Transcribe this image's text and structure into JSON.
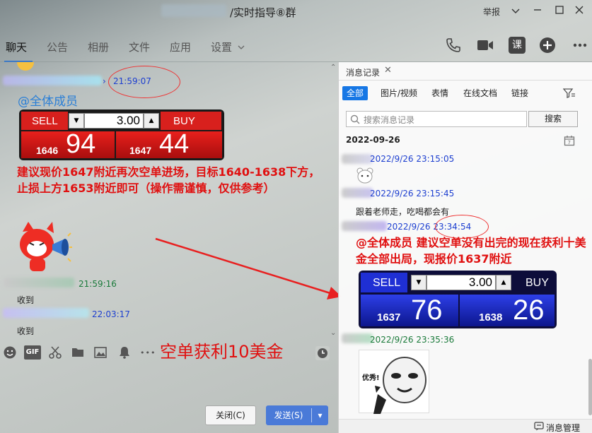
{
  "window": {
    "title": "/实时指导⑧群",
    "report_label": "举报",
    "controls": [
      "chevron-down",
      "minimize",
      "maximize",
      "close"
    ]
  },
  "tabs": [
    {
      "label": "聊天",
      "active": true
    },
    {
      "label": "公告"
    },
    {
      "label": "相册"
    },
    {
      "label": "文件"
    },
    {
      "label": "应用"
    },
    {
      "label": "设置"
    }
  ],
  "toolbar_icons": [
    "phone-icon",
    "video-icon",
    "course-icon",
    "add-icon",
    "more-icon"
  ],
  "toolbar_course_label": "课",
  "chat": {
    "msg1": {
      "time": "21:59:07",
      "arrow": "›",
      "mention": "@全体成员",
      "ticket": {
        "sell_label": "SELL",
        "buy_label": "BUY",
        "qty": "3.00",
        "spin_down": "▼",
        "spin_up": "▲",
        "sell_small": "1646",
        "sell_big": "94",
        "buy_small": "1647",
        "buy_big": "44"
      },
      "text": "建议现价1647附近再次空单进场，目标1640-1638下方，止损上方1653附近即可（操作需谨慎，仅供参考）"
    },
    "msg2": {
      "time": "21:59:16",
      "text": "收到"
    },
    "msg3": {
      "time": "22:03:17",
      "text": "收到"
    },
    "overlay_text": "空单获利10美金"
  },
  "input_toolbar": {
    "icons": [
      "emoji-icon",
      "gif-icon",
      "scissors-icon",
      "folder-icon",
      "image-icon",
      "bell-icon",
      "more-dots-icon"
    ],
    "gif_label": "GIF",
    "more_dots": "•••"
  },
  "buttons": {
    "close": "关闭(C)",
    "send": "发送(S)",
    "send_dropdown": "▾"
  },
  "history": {
    "tab_title": "消息记录",
    "close": "✕",
    "filters": [
      "全部",
      "图片/视频",
      "表情",
      "在线文档",
      "链接"
    ],
    "search_placeholder": "搜索消息记录",
    "search_button": "搜索",
    "date": "2022-09-26",
    "entries": [
      {
        "time": "2022/9/26 23:15:05"
      },
      {
        "time": "2022/9/26 23:15:45",
        "text": "跟着老师走，吃喝都会有"
      },
      {
        "time": "2022/9/26 23:34:54",
        "text": "@全体成员 建议空单没有出完的现在获利十美金全部出局，现报价1637附近"
      },
      {
        "time": "2022/9/26 23:35:36"
      }
    ],
    "ticket": {
      "sell_label": "SELL",
      "buy_label": "BUY",
      "qty": "3.00",
      "spin_down": "▼",
      "spin_up": "▲",
      "sell_small": "1637",
      "sell_big": "76",
      "buy_small": "1638",
      "buy_big": "26"
    },
    "sticker_text": "优秀!",
    "footer_label": "消息管理"
  }
}
